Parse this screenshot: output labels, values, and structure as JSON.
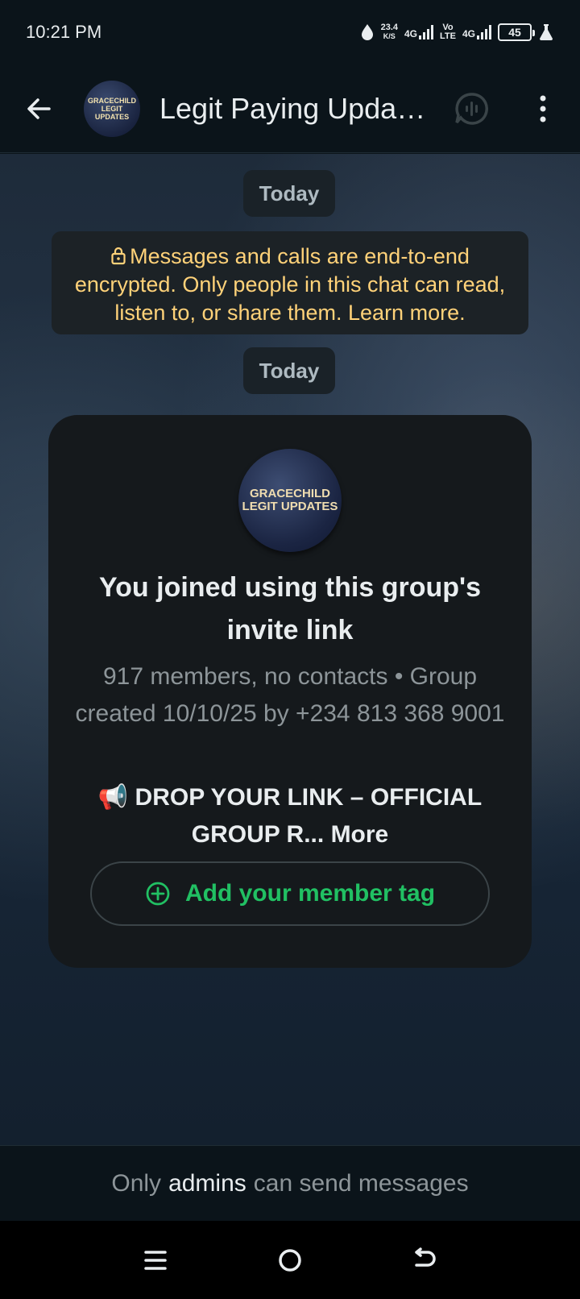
{
  "status_bar": {
    "time": "10:21 PM",
    "net_speed_value": "23.4",
    "net_speed_unit": "K/S",
    "signal1_label": "4G",
    "volte_label_top": "Vo",
    "volte_label_bottom": "LTE",
    "signal2_label": "4G",
    "battery": "45"
  },
  "header": {
    "avatar_text_line1": "GRACECHILD",
    "avatar_text_line2": "LEGIT UPDATES",
    "title": "Legit Paying Updates"
  },
  "chat": {
    "date_chip_1": "Today",
    "encryption_notice": "Messages and calls are end-to-end encrypted. Only people in this chat can read, listen to, or share them. Learn more.",
    "date_chip_2": "Today"
  },
  "card": {
    "avatar_text_line1": "GRACECHILD",
    "avatar_text_line2": "LEGIT UPDATES",
    "joined_text": "You joined using this group's invite link",
    "group_info": "917 members, no contacts • Group created 10/10/25 by +234 813 368 9001",
    "description_emoji": "📢",
    "description": "DROP YOUR LINK – OFFICIAL GROUP R...",
    "more_label": "More",
    "add_tag_label": "Add your member tag"
  },
  "bottom": {
    "prefix": "Only",
    "emphasis": "admins",
    "suffix": "can send messages"
  },
  "colors": {
    "background": "#0b141a",
    "accent_green": "#21c063",
    "notice_yellow": "#ffd279",
    "muted_text": "#8d9599"
  },
  "icons": {
    "back": "back-arrow-icon",
    "voice_chat": "voice-chat-icon",
    "menu": "more-vertical-icon",
    "lock": "lock-icon",
    "add": "plus-circle-icon",
    "nav_menu": "menu-icon",
    "nav_home": "home-icon",
    "nav_back": "back-icon"
  }
}
